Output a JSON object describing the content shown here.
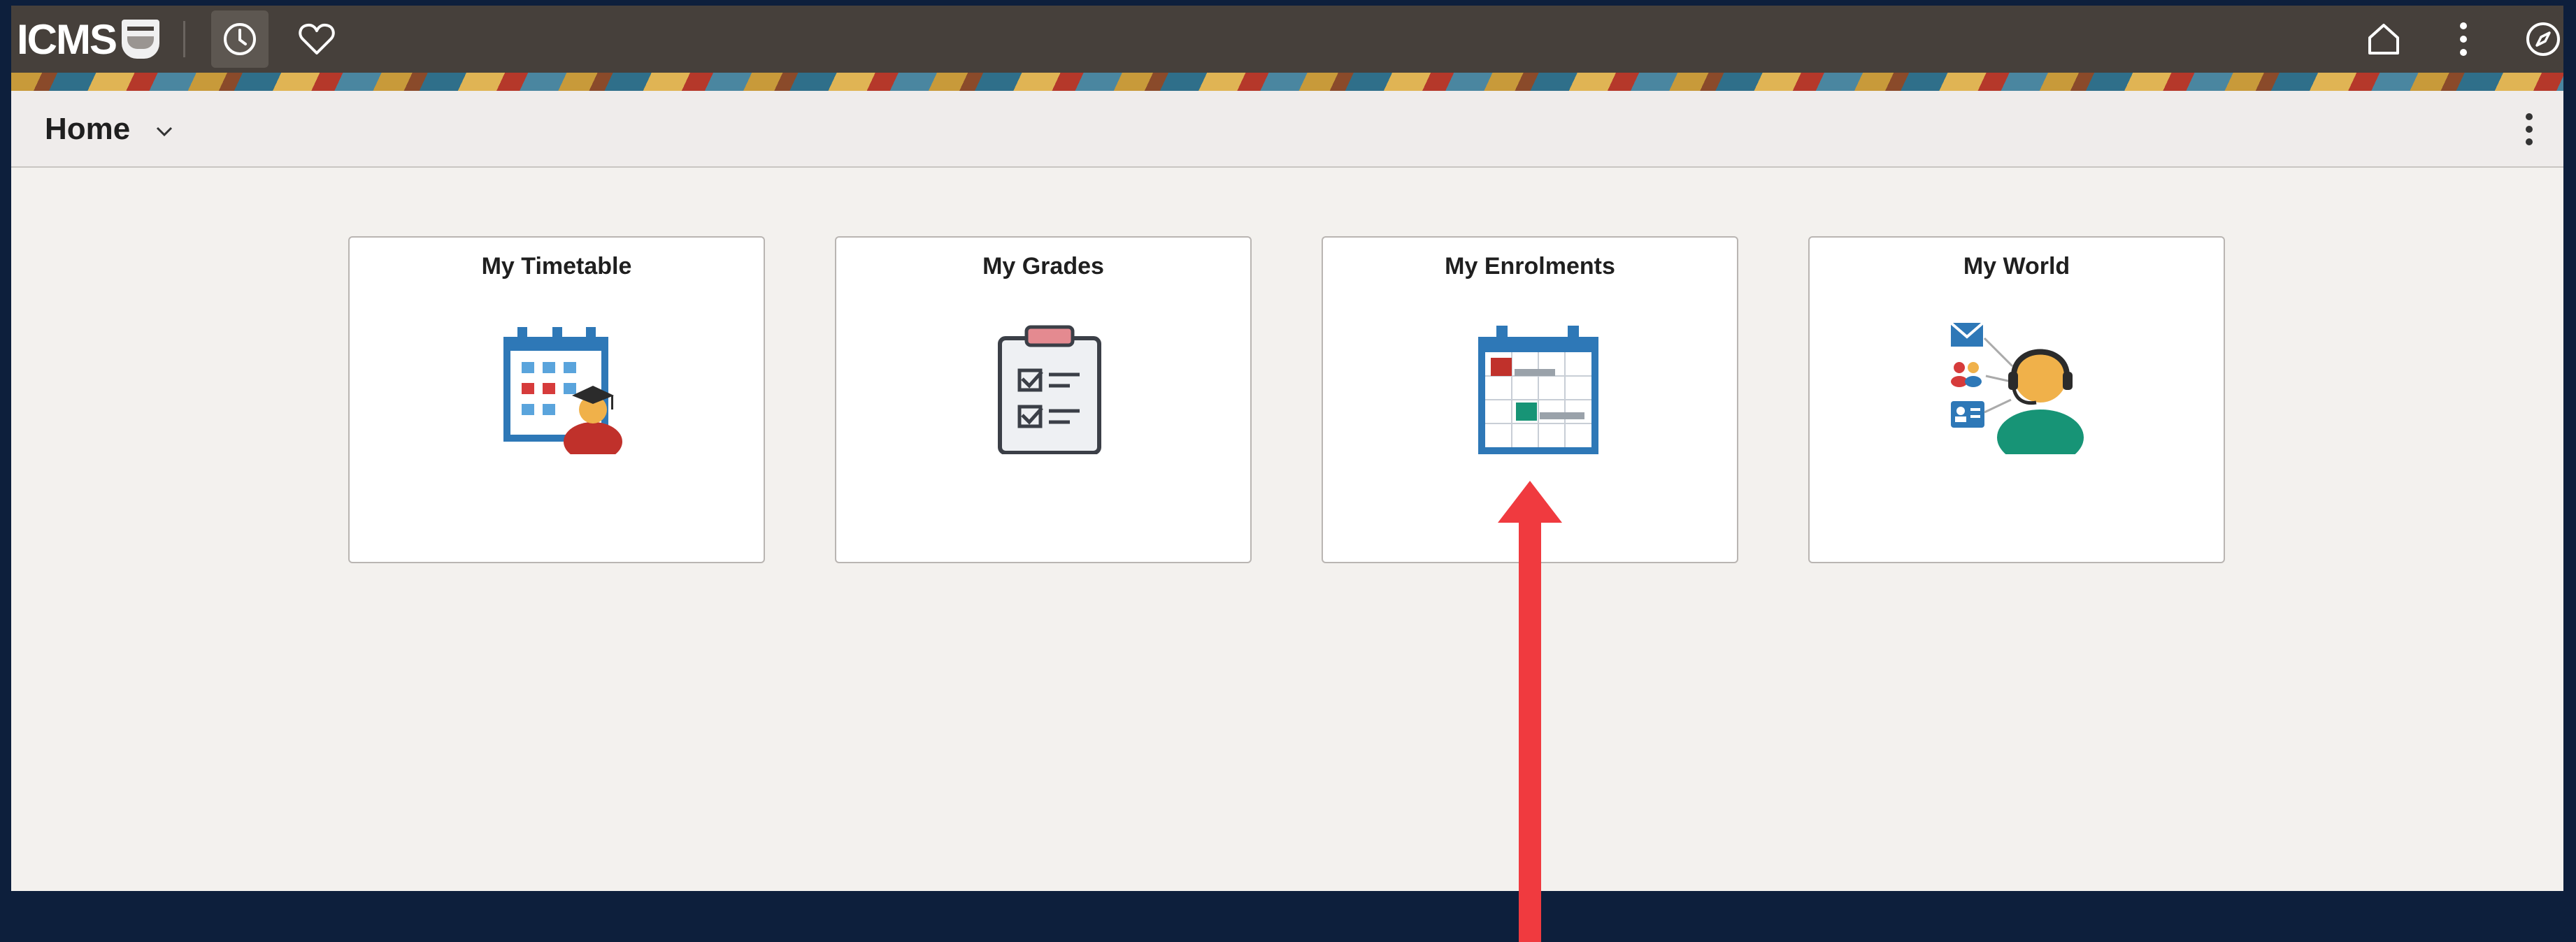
{
  "topbar": {
    "logo_text": "ICMS",
    "icons": {
      "recent": "clock-icon",
      "favorites": "heart-icon",
      "home": "home-icon",
      "actions": "vertical-dots-icon",
      "navigator": "compass-icon"
    }
  },
  "header": {
    "title": "Home"
  },
  "tiles": [
    {
      "title": "My Timetable",
      "icon": "timetable-calendar-student-icon"
    },
    {
      "title": "My Grades",
      "icon": "clipboard-checklist-icon"
    },
    {
      "title": "My Enrolments",
      "icon": "enrolment-calendar-icon"
    },
    {
      "title": "My World",
      "icon": "support-agent-contacts-icon"
    }
  ],
  "colors": {
    "topbar": "#46403b",
    "page_bg": "#f3f1ee",
    "outer_bg": "#0d1f3c",
    "accent_blue": "#2e78b7",
    "annotation_arrow": "#f03a3f"
  }
}
